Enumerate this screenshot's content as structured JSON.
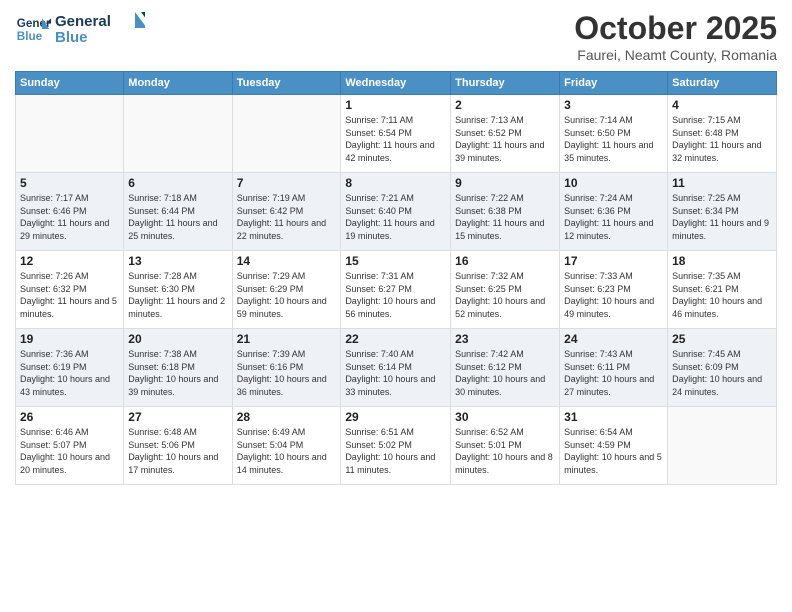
{
  "header": {
    "logo_line1": "General",
    "logo_line2": "Blue",
    "month_title": "October 2025",
    "location": "Faurei, Neamt County, Romania"
  },
  "weekdays": [
    "Sunday",
    "Monday",
    "Tuesday",
    "Wednesday",
    "Thursday",
    "Friday",
    "Saturday"
  ],
  "weeks": [
    [
      {
        "day": "",
        "sunrise": "",
        "sunset": "",
        "daylight": ""
      },
      {
        "day": "",
        "sunrise": "",
        "sunset": "",
        "daylight": ""
      },
      {
        "day": "",
        "sunrise": "",
        "sunset": "",
        "daylight": ""
      },
      {
        "day": "1",
        "sunrise": "Sunrise: 7:11 AM",
        "sunset": "Sunset: 6:54 PM",
        "daylight": "Daylight: 11 hours and 42 minutes."
      },
      {
        "day": "2",
        "sunrise": "Sunrise: 7:13 AM",
        "sunset": "Sunset: 6:52 PM",
        "daylight": "Daylight: 11 hours and 39 minutes."
      },
      {
        "day": "3",
        "sunrise": "Sunrise: 7:14 AM",
        "sunset": "Sunset: 6:50 PM",
        "daylight": "Daylight: 11 hours and 35 minutes."
      },
      {
        "day": "4",
        "sunrise": "Sunrise: 7:15 AM",
        "sunset": "Sunset: 6:48 PM",
        "daylight": "Daylight: 11 hours and 32 minutes."
      }
    ],
    [
      {
        "day": "5",
        "sunrise": "Sunrise: 7:17 AM",
        "sunset": "Sunset: 6:46 PM",
        "daylight": "Daylight: 11 hours and 29 minutes."
      },
      {
        "day": "6",
        "sunrise": "Sunrise: 7:18 AM",
        "sunset": "Sunset: 6:44 PM",
        "daylight": "Daylight: 11 hours and 25 minutes."
      },
      {
        "day": "7",
        "sunrise": "Sunrise: 7:19 AM",
        "sunset": "Sunset: 6:42 PM",
        "daylight": "Daylight: 11 hours and 22 minutes."
      },
      {
        "day": "8",
        "sunrise": "Sunrise: 7:21 AM",
        "sunset": "Sunset: 6:40 PM",
        "daylight": "Daylight: 11 hours and 19 minutes."
      },
      {
        "day": "9",
        "sunrise": "Sunrise: 7:22 AM",
        "sunset": "Sunset: 6:38 PM",
        "daylight": "Daylight: 11 hours and 15 minutes."
      },
      {
        "day": "10",
        "sunrise": "Sunrise: 7:24 AM",
        "sunset": "Sunset: 6:36 PM",
        "daylight": "Daylight: 11 hours and 12 minutes."
      },
      {
        "day": "11",
        "sunrise": "Sunrise: 7:25 AM",
        "sunset": "Sunset: 6:34 PM",
        "daylight": "Daylight: 11 hours and 9 minutes."
      }
    ],
    [
      {
        "day": "12",
        "sunrise": "Sunrise: 7:26 AM",
        "sunset": "Sunset: 6:32 PM",
        "daylight": "Daylight: 11 hours and 5 minutes."
      },
      {
        "day": "13",
        "sunrise": "Sunrise: 7:28 AM",
        "sunset": "Sunset: 6:30 PM",
        "daylight": "Daylight: 11 hours and 2 minutes."
      },
      {
        "day": "14",
        "sunrise": "Sunrise: 7:29 AM",
        "sunset": "Sunset: 6:29 PM",
        "daylight": "Daylight: 10 hours and 59 minutes."
      },
      {
        "day": "15",
        "sunrise": "Sunrise: 7:31 AM",
        "sunset": "Sunset: 6:27 PM",
        "daylight": "Daylight: 10 hours and 56 minutes."
      },
      {
        "day": "16",
        "sunrise": "Sunrise: 7:32 AM",
        "sunset": "Sunset: 6:25 PM",
        "daylight": "Daylight: 10 hours and 52 minutes."
      },
      {
        "day": "17",
        "sunrise": "Sunrise: 7:33 AM",
        "sunset": "Sunset: 6:23 PM",
        "daylight": "Daylight: 10 hours and 49 minutes."
      },
      {
        "day": "18",
        "sunrise": "Sunrise: 7:35 AM",
        "sunset": "Sunset: 6:21 PM",
        "daylight": "Daylight: 10 hours and 46 minutes."
      }
    ],
    [
      {
        "day": "19",
        "sunrise": "Sunrise: 7:36 AM",
        "sunset": "Sunset: 6:19 PM",
        "daylight": "Daylight: 10 hours and 43 minutes."
      },
      {
        "day": "20",
        "sunrise": "Sunrise: 7:38 AM",
        "sunset": "Sunset: 6:18 PM",
        "daylight": "Daylight: 10 hours and 39 minutes."
      },
      {
        "day": "21",
        "sunrise": "Sunrise: 7:39 AM",
        "sunset": "Sunset: 6:16 PM",
        "daylight": "Daylight: 10 hours and 36 minutes."
      },
      {
        "day": "22",
        "sunrise": "Sunrise: 7:40 AM",
        "sunset": "Sunset: 6:14 PM",
        "daylight": "Daylight: 10 hours and 33 minutes."
      },
      {
        "day": "23",
        "sunrise": "Sunrise: 7:42 AM",
        "sunset": "Sunset: 6:12 PM",
        "daylight": "Daylight: 10 hours and 30 minutes."
      },
      {
        "day": "24",
        "sunrise": "Sunrise: 7:43 AM",
        "sunset": "Sunset: 6:11 PM",
        "daylight": "Daylight: 10 hours and 27 minutes."
      },
      {
        "day": "25",
        "sunrise": "Sunrise: 7:45 AM",
        "sunset": "Sunset: 6:09 PM",
        "daylight": "Daylight: 10 hours and 24 minutes."
      }
    ],
    [
      {
        "day": "26",
        "sunrise": "Sunrise: 6:46 AM",
        "sunset": "Sunset: 5:07 PM",
        "daylight": "Daylight: 10 hours and 20 minutes."
      },
      {
        "day": "27",
        "sunrise": "Sunrise: 6:48 AM",
        "sunset": "Sunset: 5:06 PM",
        "daylight": "Daylight: 10 hours and 17 minutes."
      },
      {
        "day": "28",
        "sunrise": "Sunrise: 6:49 AM",
        "sunset": "Sunset: 5:04 PM",
        "daylight": "Daylight: 10 hours and 14 minutes."
      },
      {
        "day": "29",
        "sunrise": "Sunrise: 6:51 AM",
        "sunset": "Sunset: 5:02 PM",
        "daylight": "Daylight: 10 hours and 11 minutes."
      },
      {
        "day": "30",
        "sunrise": "Sunrise: 6:52 AM",
        "sunset": "Sunset: 5:01 PM",
        "daylight": "Daylight: 10 hours and 8 minutes."
      },
      {
        "day": "31",
        "sunrise": "Sunrise: 6:54 AM",
        "sunset": "Sunset: 4:59 PM",
        "daylight": "Daylight: 10 hours and 5 minutes."
      },
      {
        "day": "",
        "sunrise": "",
        "sunset": "",
        "daylight": ""
      }
    ]
  ]
}
